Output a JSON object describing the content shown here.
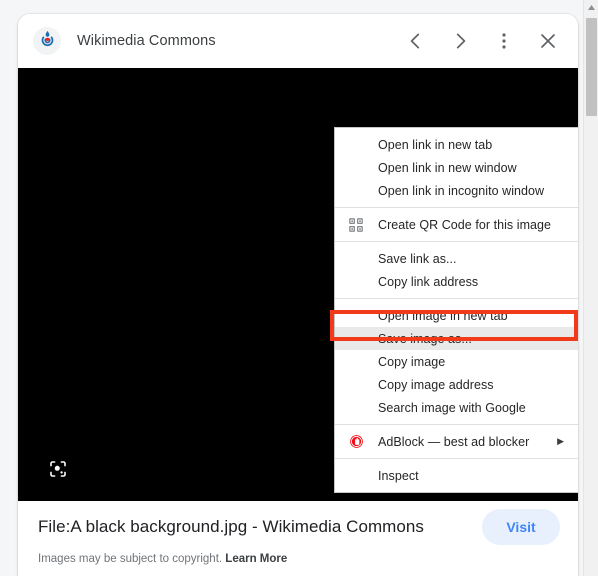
{
  "card": {
    "header": {
      "favicon_name": "wikimedia-commons-logo",
      "site_name": "Wikimedia Commons",
      "back_label": "‹",
      "forward_label": "›",
      "more_label": "⋮",
      "close_label": "×"
    },
    "image": {
      "background_color": "#000000",
      "lens_icon": "google-lens-icon"
    },
    "footer": {
      "title": "File:A black background.jpg - Wikimedia Commons",
      "visit_label": "Visit",
      "copyright_text": "Images may be subject to copyright.",
      "learn_more_label": "Learn More"
    }
  },
  "context_menu": {
    "highlight_color": "#f13a1a",
    "highlighted_item": "Save image as...",
    "groups": [
      {
        "items": [
          {
            "label": "Open link in new tab",
            "icon": "",
            "submenu": false
          },
          {
            "label": "Open link in new window",
            "icon": "",
            "submenu": false
          },
          {
            "label": "Open link in incognito window",
            "icon": "",
            "submenu": false
          }
        ]
      },
      {
        "items": [
          {
            "label": "Create QR Code for this image",
            "icon": "qr-code-icon",
            "submenu": false
          }
        ]
      },
      {
        "items": [
          {
            "label": "Save link as...",
            "icon": "",
            "submenu": false
          },
          {
            "label": "Copy link address",
            "icon": "",
            "submenu": false
          }
        ]
      },
      {
        "items": [
          {
            "label": "Open image in new tab",
            "icon": "",
            "submenu": false
          },
          {
            "label": "Save image as...",
            "icon": "",
            "submenu": false,
            "highlighted": true
          },
          {
            "label": "Copy image",
            "icon": "",
            "submenu": false
          },
          {
            "label": "Copy image address",
            "icon": "",
            "submenu": false
          },
          {
            "label": "Search image with Google",
            "icon": "",
            "submenu": false
          }
        ]
      },
      {
        "items": [
          {
            "label": "AdBlock — best ad blocker",
            "icon": "adblock-icon",
            "submenu": true,
            "arrow": "▶"
          }
        ]
      },
      {
        "items": [
          {
            "label": "Inspect",
            "icon": "",
            "submenu": false
          }
        ]
      }
    ]
  },
  "scrollbar": {
    "up_arrow": "▲",
    "thumb_color": "#c1c1c1"
  }
}
